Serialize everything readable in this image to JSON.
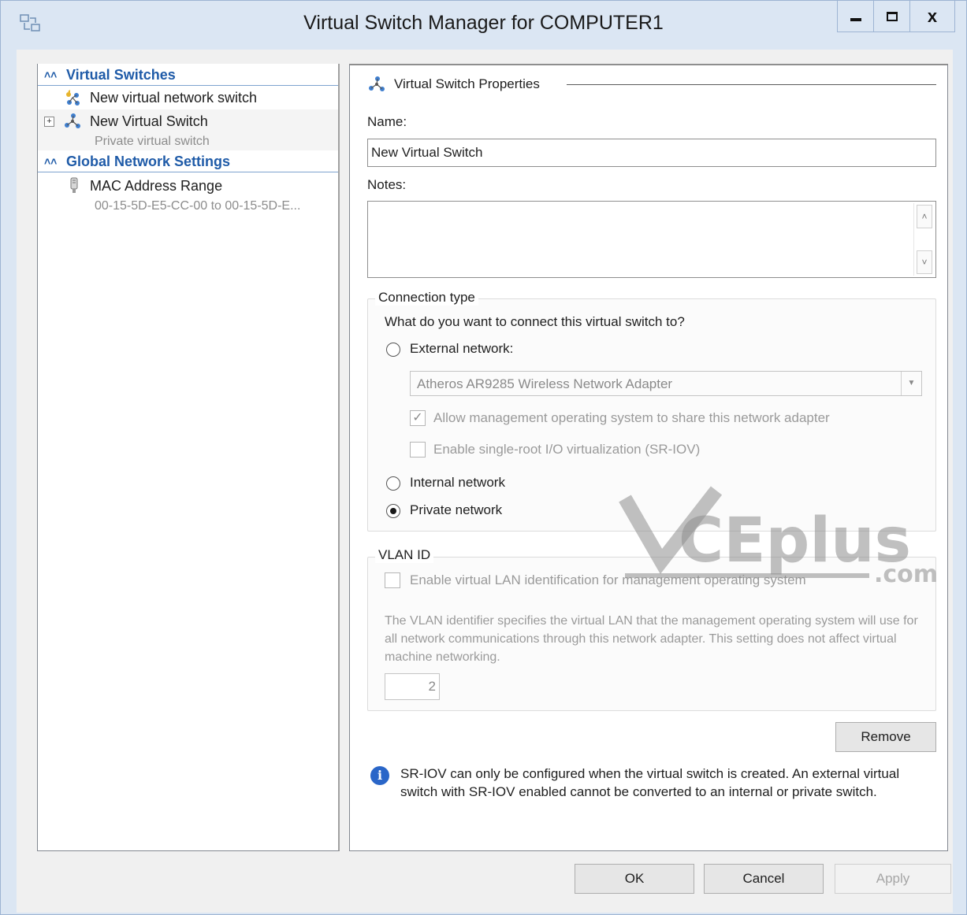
{
  "window": {
    "title": "Virtual Switch Manager for COMPUTER1",
    "controls": {
      "minimize": "minimize-icon",
      "maximize": "maximize-icon",
      "close_label": "x"
    }
  },
  "sidebar": {
    "virtual_switches_header": "Virtual Switches",
    "new_switch_label": "New virtual network switch",
    "switch_name": "New Virtual Switch",
    "switch_type": "Private virtual switch",
    "global_header": "Global Network Settings",
    "mac_label": "MAC Address Range",
    "mac_value": "00-15-5D-E5-CC-00 to 00-15-5D-E..."
  },
  "properties": {
    "section_title": "Virtual Switch Properties",
    "name_label": "Name:",
    "name_value": "New Virtual Switch",
    "notes_label": "Notes:",
    "connection": {
      "group_title": "Connection type",
      "question": "What do you want to connect this virtual switch to?",
      "external_label": "External network:",
      "adapter": "Atheros AR9285 Wireless Network Adapter",
      "allow_mgmt": "Allow management operating system to share this network adapter",
      "allow_mgmt_checked": true,
      "sriov": "Enable single-root I/O virtualization (SR-IOV)",
      "sriov_checked": false,
      "internal_label": "Internal network",
      "private_label": "Private network",
      "selected": "private"
    },
    "vlan": {
      "group_title": "VLAN ID",
      "enable_label": "Enable virtual LAN identification for management operating system",
      "enable_checked": false,
      "description": "The VLAN identifier specifies the virtual LAN that the management operating system will use for all network communications through this network adapter. This setting does not affect virtual machine networking.",
      "value": "2"
    },
    "remove_label": "Remove",
    "info_text": "SR-IOV can only be configured when the virtual switch is created. An external virtual switch with SR-IOV enabled cannot be converted to an internal or private switch."
  },
  "footer": {
    "ok_label": "OK",
    "cancel_label": "Cancel",
    "apply_label": "Apply"
  },
  "watermark": {
    "text": "CEplus",
    "sub": ".com"
  }
}
